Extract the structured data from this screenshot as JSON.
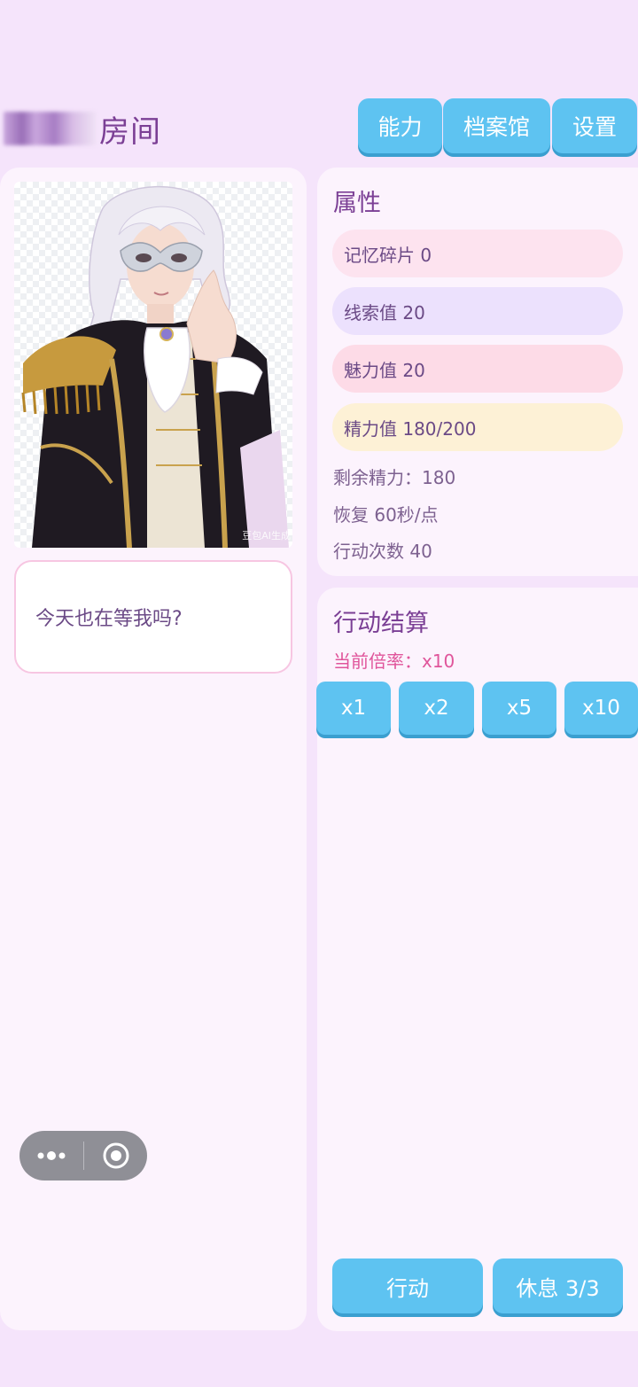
{
  "header": {
    "title": "房间",
    "nav": [
      {
        "label": "能力"
      },
      {
        "label": "档案馆"
      },
      {
        "label": "设置"
      }
    ]
  },
  "character": {
    "image_alt": "masked-nobleman-portrait",
    "watermark": "豆包AI生成",
    "speech": "今天也在等我吗?"
  },
  "attributes": {
    "title": "属性",
    "pills": [
      {
        "label": "记忆碎片 0",
        "color": "#fde3ef"
      },
      {
        "label": "线索值 20",
        "color": "#ece1fd"
      },
      {
        "label": "魅力值 20",
        "color": "#fddbe7"
      },
      {
        "label": "精力值 180/200",
        "color": "#fdf1d6"
      }
    ],
    "stats": [
      {
        "label": "剩余精力：180"
      },
      {
        "label": "恢复 60秒/点"
      },
      {
        "label": "行动次数 40"
      }
    ]
  },
  "action": {
    "title": "行动结算",
    "rate": "当前倍率：x10",
    "multipliers": [
      {
        "label": "x1"
      },
      {
        "label": "x2"
      },
      {
        "label": "x5"
      },
      {
        "label": "x10"
      }
    ],
    "act_label": "行动",
    "rest_label": "休息 3/3"
  },
  "capsule": {
    "more_icon": "more-dots-icon",
    "close_icon": "target-circle-icon"
  },
  "colors": {
    "accent": "#5ec3f1",
    "background": "#f5e4fb",
    "panel": "#fcf3fd",
    "title": "#7b3f95",
    "rate": "#e0559b"
  }
}
